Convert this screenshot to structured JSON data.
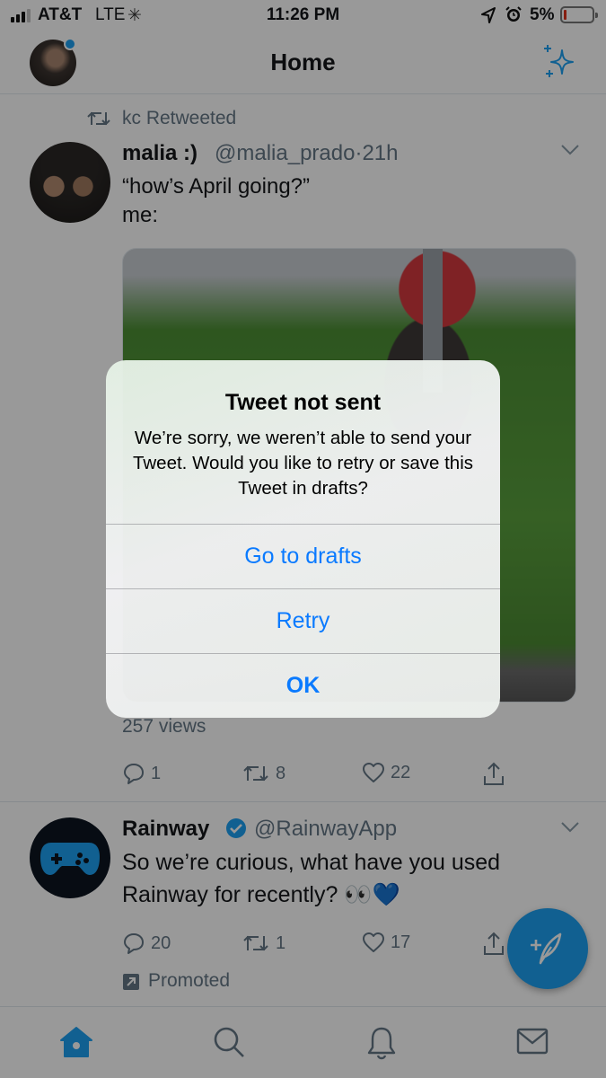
{
  "status_bar": {
    "carrier": "AT&T",
    "network": "LTE",
    "time": "11:26 PM",
    "battery_percent": "5%",
    "battery_level": 0.05,
    "icons": [
      "signal-icon",
      "activity-spinner-icon",
      "location-arrow-icon",
      "alarm-clock-icon",
      "battery-icon"
    ]
  },
  "header": {
    "title": "Home",
    "icons": [
      "profile-avatar",
      "sparkle-icon"
    ]
  },
  "tweets": [
    {
      "retweeted_by": "kc Retweeted",
      "name": "malia :)",
      "handle": "@malia_prado",
      "separator": "·",
      "age": "21h",
      "text_line1": "“how’s April going?”",
      "text_line2": "me:",
      "views": "257 views",
      "actions": {
        "replies": "1",
        "retweets": "8",
        "likes": "22"
      }
    },
    {
      "name": "Rainway",
      "handle": "@RainwayApp",
      "text": "So we’re curious, what have you used Rainway for recently? 👀💙",
      "actions": {
        "replies": "20",
        "retweets": "1",
        "likes": "17"
      },
      "promoted": "Promoted"
    }
  ],
  "tab_bar": {
    "tabs": [
      "home-icon",
      "search-icon",
      "notifications-bell-icon",
      "messages-envelope-icon"
    ]
  },
  "alert": {
    "title": "Tweet not sent",
    "message": "We’re sorry, we weren’t able to send your Tweet. Would you like to retry or save this Tweet in drafts?",
    "buttons": [
      "Go to drafts",
      "Retry",
      "OK"
    ]
  },
  "colors": {
    "accent": "#1da1f2",
    "ios_blue": "#0a7aff",
    "secondary_text": "#657786",
    "battery_low": "#e0331b"
  }
}
